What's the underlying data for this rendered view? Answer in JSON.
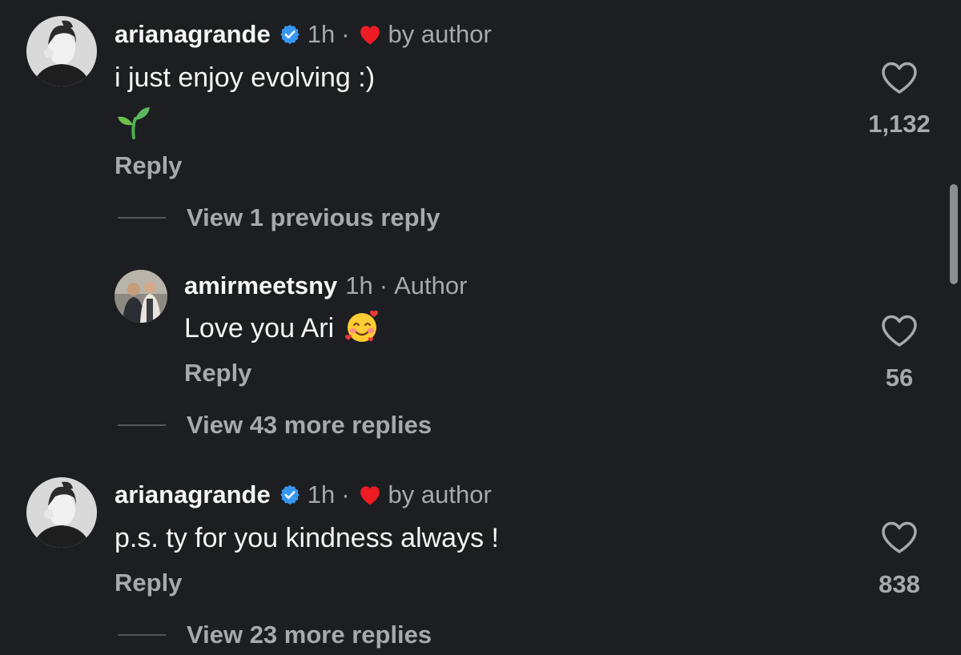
{
  "comments": [
    {
      "username": "arianagrande",
      "verified": true,
      "time": "1h",
      "separator": "·",
      "liked_by_author": "by author",
      "text": "i just enjoy evolving :)",
      "emoji": "seedling",
      "reply_label": "Reply",
      "like_count": "1,132",
      "view_replies": "View 1 previous reply"
    },
    {
      "username": "amirmeetsny",
      "time": "1h",
      "separator": "·",
      "author_badge": "Author",
      "text": "Love you Ari",
      "emoji": "smiling-face-with-hearts",
      "reply_label": "Reply",
      "like_count": "56",
      "view_replies": "View 43 more replies"
    },
    {
      "username": "arianagrande",
      "verified": true,
      "time": "1h",
      "separator": "·",
      "liked_by_author": "by author",
      "text": "p.s. ty for you kindness always !",
      "reply_label": "Reply",
      "like_count": "838",
      "view_replies": "View 23 more replies"
    }
  ],
  "colors": {
    "background": "#1c1e21",
    "primary_text": "#f5f5f5",
    "secondary_text": "#a8a9ad",
    "verified_blue": "#3897f0",
    "heart_red": "#ed1c24"
  },
  "icons": [
    "verified-badge-icon",
    "heart-filled-icon",
    "heart-outline-icon",
    "seedling-emoji",
    "smiling-face-with-hearts-emoji"
  ]
}
